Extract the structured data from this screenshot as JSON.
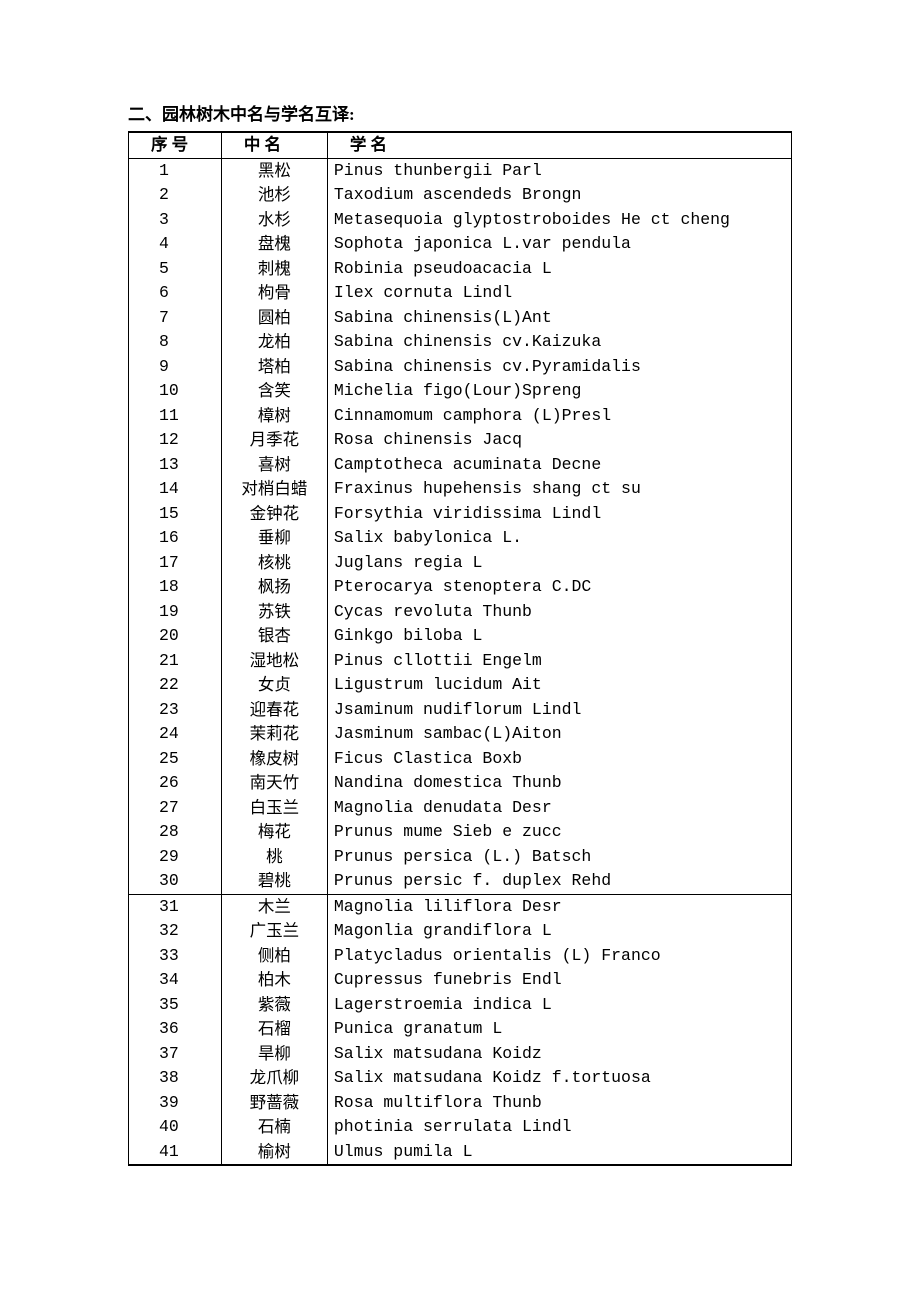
{
  "title": "二、园林树木中名与学名互译:",
  "chart_data": {
    "type": "table",
    "columns": [
      "序    号",
      "中    名",
      "学                           名"
    ],
    "rows": [
      [
        1,
        "黑松",
        "Pinus thunbergii Parl"
      ],
      [
        2,
        "池杉",
        "Taxodium ascendeds Brongn"
      ],
      [
        3,
        "水杉",
        "Metasequoia glyptostroboides He ct cheng"
      ],
      [
        4,
        "盘槐",
        "Sophota japonica L.var pendula"
      ],
      [
        5,
        "刺槐",
        "Robinia pseudoacacia L"
      ],
      [
        6,
        "枸骨",
        "Ilex cornuta Lindl"
      ],
      [
        7,
        "圆柏",
        "Sabina chinensis(L)Ant"
      ],
      [
        8,
        "龙柏",
        "Sabina chinensis cv.Kaizuka"
      ],
      [
        9,
        "塔柏",
        "Sabina chinensis cv.Pyramidalis"
      ],
      [
        10,
        "含笑",
        "Michelia figo(Lour)Spreng"
      ],
      [
        11,
        "樟树",
        "Cinnamomum camphora (L)Presl"
      ],
      [
        12,
        "月季花",
        "Rosa chinensis Jacq"
      ],
      [
        13,
        "喜树",
        "Camptotheca acuminata Decne"
      ],
      [
        14,
        "对梢白蜡",
        "Fraxinus hupehensis shang ct su"
      ],
      [
        15,
        "金钟花",
        "Forsythia viridissima Lindl"
      ],
      [
        16,
        "垂柳",
        "Salix babylonica L."
      ],
      [
        17,
        "核桃",
        "Juglans regia L"
      ],
      [
        18,
        "枫扬",
        "Pterocarya stenoptera C.DC"
      ],
      [
        19,
        "苏铁",
        "Cycas revoluta Thunb"
      ],
      [
        20,
        "银杏",
        "Ginkgo biloba L"
      ],
      [
        21,
        "湿地松",
        "Pinus cllottii Engelm"
      ],
      [
        22,
        "女贞",
        "Ligustrum lucidum Ait"
      ],
      [
        23,
        "迎春花",
        "Jsaminum nudiflorum Lindl"
      ],
      [
        24,
        "茉莉花",
        "Jasminum sambac(L)Aiton"
      ],
      [
        25,
        "橡皮树",
        "Ficus Clastica Boxb"
      ],
      [
        26,
        "南天竹",
        "Nandina domestica Thunb"
      ],
      [
        27,
        "白玉兰",
        "Magnolia denudata Desr"
      ],
      [
        28,
        "梅花",
        "Prunus mume Sieb e zucc"
      ],
      [
        29,
        "桃",
        "Prunus persica (L.) Batsch"
      ],
      [
        30,
        "碧桃",
        "Prunus persic f. duplex Rehd"
      ],
      [
        31,
        "木兰",
        "Magnolia liliflora Desr"
      ],
      [
        32,
        "广玉兰",
        "Magonlia grandiflora L"
      ],
      [
        33,
        "侧柏",
        "Platycladus orientalis (L) Franco"
      ],
      [
        34,
        "柏木",
        "Cupressus funebris Endl"
      ],
      [
        35,
        "紫薇",
        "Lagerstroemia indica L"
      ],
      [
        36,
        "石榴",
        "Punica granatum L"
      ],
      [
        37,
        "旱柳",
        "Salix matsudana Koidz"
      ],
      [
        38,
        "龙爪柳",
        "Salix matsudana Koidz f.tortuosa"
      ],
      [
        39,
        "野蔷薇",
        "Rosa multiflora Thunb"
      ],
      [
        40,
        "石楠",
        "photinia serrulata Lindl"
      ],
      [
        41,
        "榆树",
        "Ulmus pumila L"
      ]
    ],
    "section_break_after_index": 30
  }
}
